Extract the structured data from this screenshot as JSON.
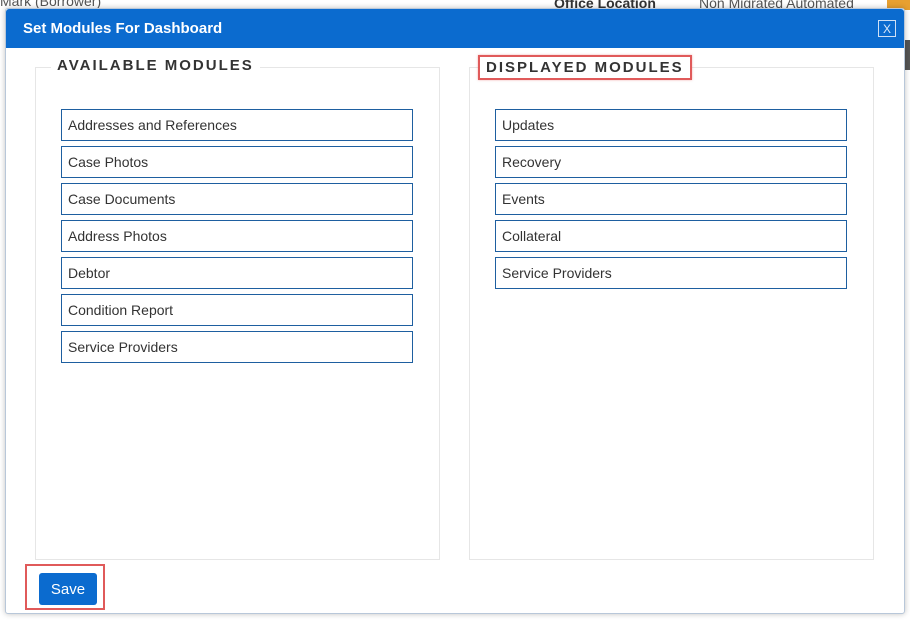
{
  "background": {
    "borrower_text": "Mark (Borrower)",
    "office_location_label": "Office Location",
    "office_location_value": "Non Migrated Automated"
  },
  "modal": {
    "title": "Set Modules For Dashboard",
    "close_label": "X",
    "available": {
      "heading": "AVAILABLE MODULES",
      "items": [
        "Addresses and References",
        "Case Photos",
        "Case Documents",
        "Address Photos",
        "Debtor",
        "Condition Report",
        "Service Providers"
      ]
    },
    "displayed": {
      "heading": "DISPLAYED MODULES",
      "items": [
        "Updates",
        "Recovery",
        "Events",
        "Collateral",
        "Service Providers"
      ]
    },
    "save_label": "Save"
  },
  "colors": {
    "header_blue": "#0b6bcf",
    "item_border": "#1e5fa0",
    "highlight_red": "#e05a5a"
  }
}
